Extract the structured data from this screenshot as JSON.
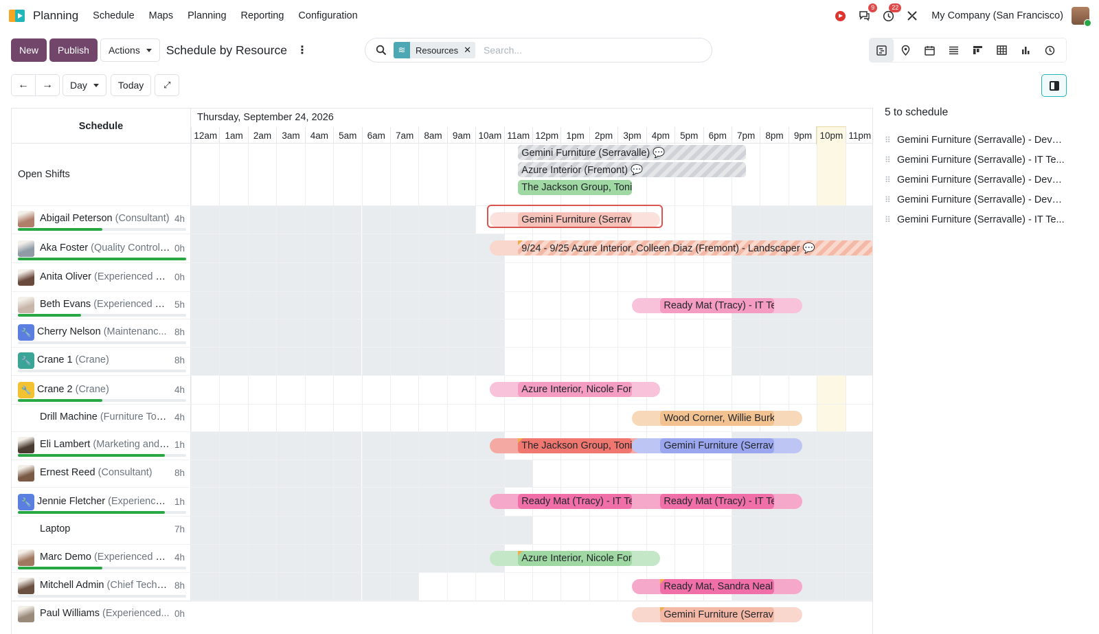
{
  "app": {
    "name": "Planning",
    "menu": [
      "Schedule",
      "Maps",
      "Planning",
      "Reporting",
      "Configuration"
    ]
  },
  "systray": {
    "messages_count": "9",
    "activities_count": "22",
    "company": "My Company (San Francisco)"
  },
  "control": {
    "new_label": "New",
    "publish_label": "Publish",
    "actions_label": "Actions",
    "title": "Schedule by Resource",
    "search_facet": "Resources",
    "search_placeholder": "Search...",
    "day_label": "Day",
    "today_label": "Today"
  },
  "gantt": {
    "header_label": "Schedule",
    "date_label": "Thursday, September 24, 2026",
    "hours": [
      "12am",
      "1am",
      "2am",
      "3am",
      "4am",
      "5am",
      "6am",
      "7am",
      "8am",
      "9am",
      "10am",
      "11am",
      "12pm",
      "1pm",
      "2pm",
      "3pm",
      "4pm",
      "5pm",
      "6pm",
      "7pm",
      "8pm",
      "9pm",
      "10pm",
      "11pm"
    ],
    "open_shifts_label": "Open Shifts",
    "rows": [
      {
        "name": "Abigail Peterson",
        "role": "(Consultant)",
        "hours": "4h",
        "progress": 0.5
      },
      {
        "name": "Aka Foster",
        "role": "(Quality Control ...",
        "hours": "0h",
        "progress": 1.0
      },
      {
        "name": "Anita Oliver",
        "role": "(Experienced D...",
        "hours": "0h",
        "progress": null
      },
      {
        "name": "Beth Evans",
        "role": "(Experienced D...",
        "hours": "5h",
        "progress": 0.375
      },
      {
        "name": "Cherry Nelson",
        "role": "(Maintenanc...",
        "hours": "8h",
        "progress": 0
      },
      {
        "name": "Crane 1",
        "role": "(Crane)",
        "hours": "8h",
        "progress": 0
      },
      {
        "name": "Crane 2",
        "role": "(Crane)",
        "hours": "4h",
        "progress": 0.5
      },
      {
        "name": "Drill Machine",
        "role": "(Furniture Tools)",
        "hours": "4h",
        "progress": null
      },
      {
        "name": "Eli Lambert",
        "role": "(Marketing and ...",
        "hours": "1h",
        "progress": 0.875
      },
      {
        "name": "Ernest Reed",
        "role": "(Consultant)",
        "hours": "8h",
        "progress": null
      },
      {
        "name": "Jennie Fletcher",
        "role": "(Experience...",
        "hours": "1h",
        "progress": 0.875
      },
      {
        "name": "Laptop",
        "role": "",
        "hours": "7h",
        "progress": null
      },
      {
        "name": "Marc Demo",
        "role": "(Experienced D...",
        "hours": "4h",
        "progress": 0.5
      },
      {
        "name": "Mitchell Admin",
        "role": "(Chief Techni...",
        "hours": "8h",
        "progress": 0
      },
      {
        "name": "Paul Williams",
        "role": "(Experienced...",
        "hours": "0h",
        "progress": null
      }
    ],
    "open_shift_pills": [
      {
        "label": "Gemini Furniture (Serravalle) 💬"
      },
      {
        "label": "Azure Interior (Fremont) 💬"
      },
      {
        "label": "The Jackson Group, Toni"
      }
    ],
    "pills": [
      {
        "row": 0,
        "label": "Gemini Furniture (Serrav"
      },
      {
        "row": 1,
        "label": "9/24 - 9/25 Azure Interior, Colleen Diaz (Fremont) - Landscaper 💬"
      },
      {
        "row": 3,
        "label": "Ready Mat (Tracy) - IT Te"
      },
      {
        "row": 6,
        "label": "Azure Interior, Nicole For"
      },
      {
        "row": 7,
        "label": "Wood Corner, Willie Burk"
      },
      {
        "row": 8,
        "label": "The Jackson Group, Toni"
      },
      {
        "row": 8,
        "label": "Gemini Furniture (Serrav"
      },
      {
        "row": 10,
        "label": "Ready Mat (Tracy) - IT Te"
      },
      {
        "row": 10,
        "label": "Ready Mat (Tracy) - IT Te"
      },
      {
        "row": 12,
        "label": "Azure Interior, Nicole For"
      },
      {
        "row": 13,
        "label": "Ready Mat, Sandra Neal"
      },
      {
        "row": 14,
        "label": "Gemini Furniture (Serrav"
      }
    ]
  },
  "side_panel": {
    "title": "5 to schedule",
    "items": [
      "Gemini Furniture (Serravalle) - Devel...",
      "Gemini Furniture (Serravalle) - IT Te...",
      "Gemini Furniture (Serravalle) - Devel...",
      "Gemini Furniture (Serravalle) - Devel...",
      "Gemini Furniture (Serravalle) - IT Te..."
    ]
  },
  "colors": {
    "brand": "#71466a",
    "accent": "#21b6b7",
    "progress": "#28a745"
  }
}
